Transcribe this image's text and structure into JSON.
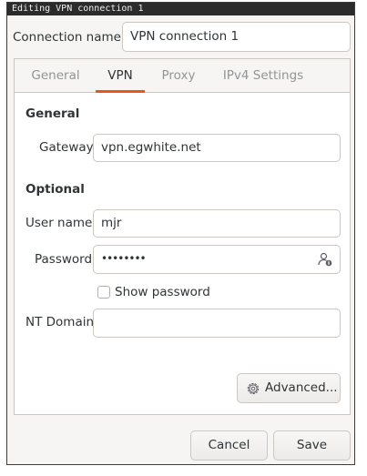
{
  "window": {
    "title": "Editing VPN connection 1"
  },
  "connection": {
    "label": "Connection name",
    "value": "VPN connection 1"
  },
  "tabs": [
    {
      "label": "General",
      "active": false
    },
    {
      "label": "VPN",
      "active": true
    },
    {
      "label": "Proxy",
      "active": false
    },
    {
      "label": "IPv4 Settings",
      "active": false
    }
  ],
  "vpn": {
    "general_title": "General",
    "gateway_label": "Gateway",
    "gateway_value": "vpn.egwhite.net",
    "optional_title": "Optional",
    "username_label": "User name",
    "username_value": "mjr",
    "password_label": "Password",
    "password_value": "••••••••",
    "show_password_label": "Show password",
    "show_password_checked": false,
    "nt_domain_label": "NT Domain",
    "nt_domain_value": "",
    "advanced_label": "Advanced..."
  },
  "footer": {
    "cancel_label": "Cancel",
    "save_label": "Save"
  },
  "icons": {
    "password_storage": "user-info-icon",
    "advanced": "gear-icon"
  },
  "colors": {
    "accent": "#e95420",
    "border": "#cdc7c2",
    "background": "#f6f5f4"
  }
}
